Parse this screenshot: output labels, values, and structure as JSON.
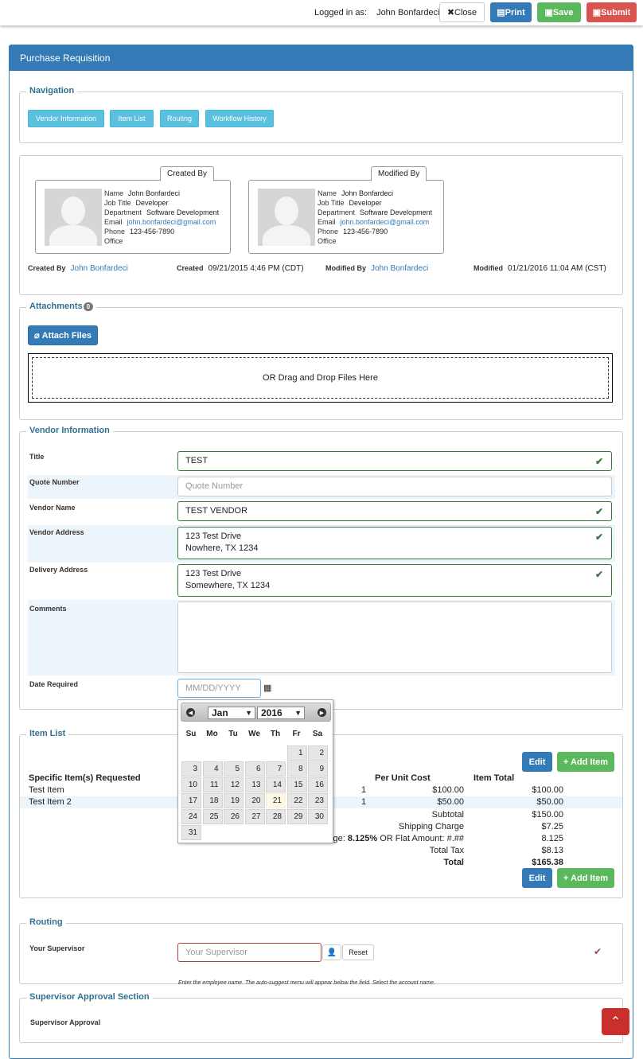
{
  "topbar": {
    "logged_label": "Logged in as:",
    "user": "John Bonfardeci",
    "close": "Close",
    "print": "Print",
    "save": "Save",
    "submit": "Submit"
  },
  "panel_title": "Purchase Requisition",
  "navigation": {
    "legend": "Navigation",
    "buttons": [
      "Vendor Information",
      "Item List",
      "Routing",
      "Workflow History"
    ]
  },
  "created_card": {
    "tab": "Created By",
    "name": "John Bonfardeci",
    "job_title": "Developer",
    "department": "Software Development",
    "email": "john.bonfardeci@gmail.com",
    "phone": "123-456-7890",
    "office": ""
  },
  "modified_card": {
    "tab": "Modified By",
    "name": "John Bonfardeci",
    "job_title": "Developer",
    "department": "Software Development",
    "email": "john.bonfardeci@gmail.com",
    "phone": "123-456-7890",
    "office": ""
  },
  "card_labels": {
    "name": "Name",
    "job_title": "Job Title",
    "department": "Department",
    "email": "Email",
    "phone": "Phone",
    "office": "Office"
  },
  "meta": {
    "created_by_label": "Created By",
    "created_by": "John Bonfardeci",
    "created_label": "Created",
    "created": "09/21/2015 4:46 PM (CDT)",
    "modified_by_label": "Modified By",
    "modified_by": "John Bonfardeci",
    "modified_label": "Modified",
    "modified": "01/21/2016 11:04 AM (CST)"
  },
  "attachments": {
    "legend": "Attachments",
    "count": "0",
    "attach_button": "Attach Files",
    "drop_text": "OR Drag and Drop Files Here"
  },
  "vendor": {
    "legend": "Vendor Information",
    "title_label": "Title",
    "title": "TEST",
    "quote_label": "Quote Number",
    "quote_placeholder": "Quote Number",
    "vendor_name_label": "Vendor Name",
    "vendor_name": "TEST VENDOR",
    "vendor_address_label": "Vendor Address",
    "vendor_address_1": "123 Test Drive",
    "vendor_address_2": "Nowhere, TX 1234",
    "delivery_label": "Delivery Address",
    "delivery_1": "123 Test Drive",
    "delivery_2": "Somewhere, TX 1234",
    "comments_label": "Comments",
    "comments": "",
    "date_label": "Date Required",
    "date_placeholder": "MM/DD/YYYY"
  },
  "calendar": {
    "month": "Jan",
    "year": "2016",
    "days_of_week": [
      "Su",
      "Mo",
      "Tu",
      "We",
      "Th",
      "Fr",
      "Sa"
    ],
    "today": "21"
  },
  "items": {
    "legend": "Item List",
    "edit": "Edit",
    "add_item": "+ Add Item",
    "col_item": "Specific Item(s) Requested",
    "col_unit_cost": "Per Unit Cost",
    "col_total": "Item Total",
    "rows": [
      {
        "name": "Test Item",
        "qty": "1",
        "unit": "$100.00",
        "total": "$100.00"
      },
      {
        "name": "Test Item 2",
        "qty": "1",
        "unit": "$50.00",
        "total": "$50.00"
      }
    ],
    "subtotal_label": "Subtotal",
    "subtotal": "$150.00",
    "shipping_label": "Shipping Charge",
    "shipping": "$7.25",
    "tax_rate_label": "age:",
    "tax_rate": "8.125%",
    "tax_rate_alt": "OR Flat Amount: #.##",
    "tax_rate_value": "8.125",
    "total_tax_label": "Total Tax",
    "total_tax": "$8.13",
    "total_label": "Total",
    "total": "$165.38"
  },
  "routing": {
    "legend": "Routing",
    "supervisor_label": "Your Supervisor",
    "supervisor_placeholder": "Your Supervisor",
    "reset": "Reset",
    "help": "Enter the employee name. The auto-suggest menu will appear below the field. Select the account name."
  },
  "approval": {
    "legend": "Supervisor Approval Section",
    "label": "Supervisor Approval"
  },
  "colors": {
    "primary": "#337ab7",
    "success": "#5cb85c",
    "danger": "#d9534f",
    "info": "#5bc0de"
  }
}
